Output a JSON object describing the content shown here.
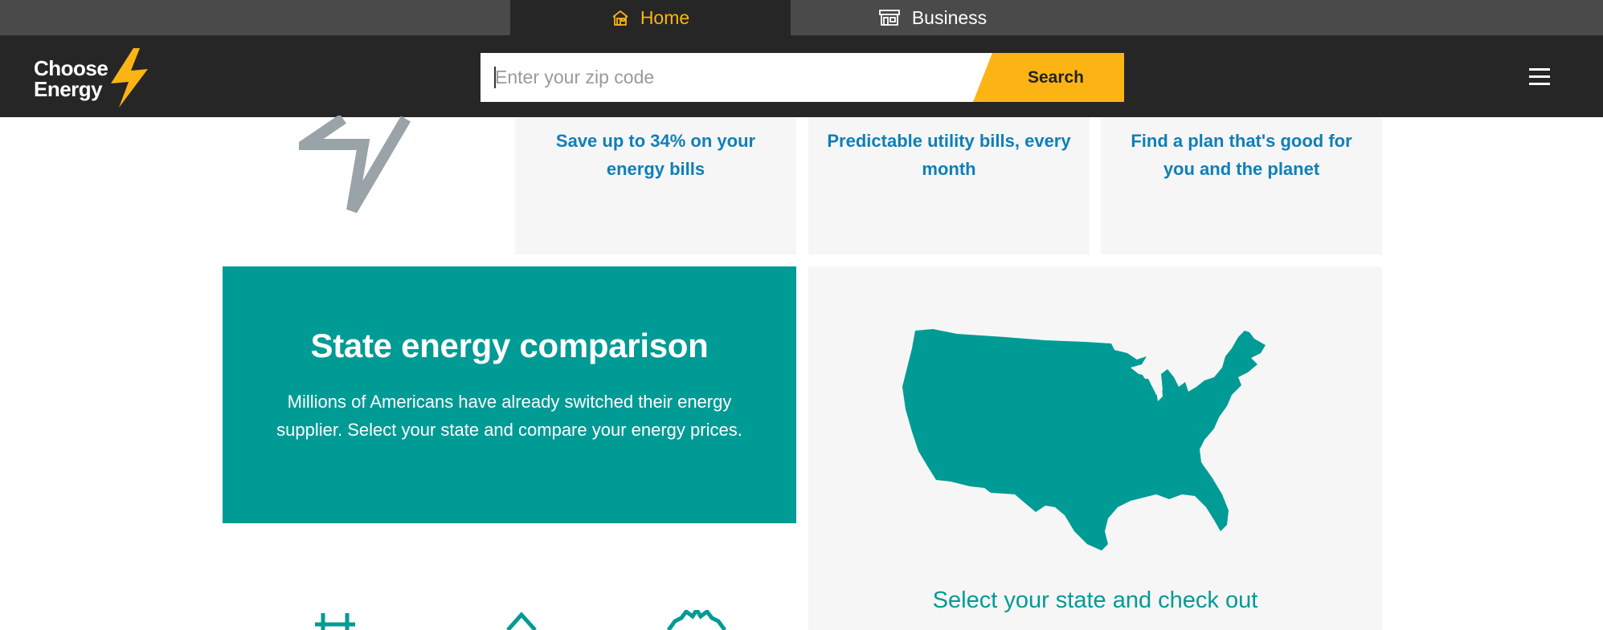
{
  "tabs": [
    {
      "label": "Home",
      "icon": "house-icon",
      "active": true
    },
    {
      "label": "Business",
      "icon": "storefront-icon",
      "active": false
    }
  ],
  "header": {
    "logo_line1": "Choose",
    "logo_line2": "Energy",
    "search_placeholder": "Enter your zip code",
    "search_value": "",
    "search_button": "Search",
    "menu_icon": "hamburger-menu-icon"
  },
  "features": [
    {
      "text": "Save up to 34% on your energy bills"
    },
    {
      "text": "Predictable utility bills, every month"
    },
    {
      "text": "Find a plan that's good for you and the planet"
    }
  ],
  "state_comparison": {
    "title": "State energy comparison",
    "body": "Millions of Americans have already switched their energy supplier. Select your state and compare your energy prices.",
    "map_caption": "Select your state and check out"
  },
  "colors": {
    "accent_yellow": "#fcb415",
    "header_dark": "#262626",
    "tab_gray": "#4a4a4a",
    "teal": "#009b95",
    "link_blue": "#0f7fb8",
    "card_gray": "#f6f6f6"
  }
}
